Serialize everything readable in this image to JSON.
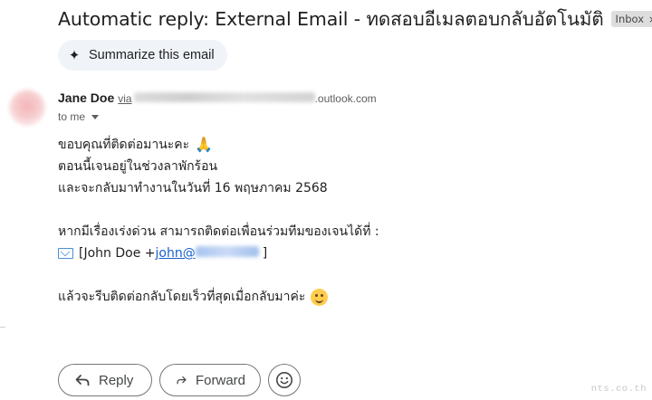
{
  "subject": "Automatic reply: External Email - ทดสอบอีเมลตอบกลับอัตโนมัติ",
  "label_chip": {
    "text": "Inbox",
    "close": "×"
  },
  "summarize": {
    "label": "Summarize this email",
    "icon": "sparkle-icon"
  },
  "sender": {
    "name": "Jane Doe",
    "via_label": "via",
    "domain_tail": ".outlook.com",
    "to_label": "to me"
  },
  "body": {
    "line1": "ขอบคุณที่ติดต่อมานะคะ",
    "line2": "ตอนนี้เจนอยู่ในช่วงลาพักร้อน",
    "line3": "และจะกลับมาทำงานในวันที่ 16 พฤษภาคม 2568",
    "line4": "หากมีเรื่องเร่งด่วน สามารถติดต่อเพื่อนร่วมทีมของเจนได้ที่ :",
    "contact_prefix": "[John Doe + ",
    "contact_email_start": "john@",
    "contact_suffix": " ]",
    "line6": "แล้วจะรีบติดต่อกลับโดยเร็วที่สุดเมื่อกลับมาค่ะ"
  },
  "actions": {
    "reply_label": "Reply",
    "forward_label": "Forward"
  },
  "watermark": "nts.co.th",
  "colors": {
    "link": "#1a5fce",
    "chip_bg": "#dddddd",
    "summarize_bg": "#f0f4f9"
  }
}
